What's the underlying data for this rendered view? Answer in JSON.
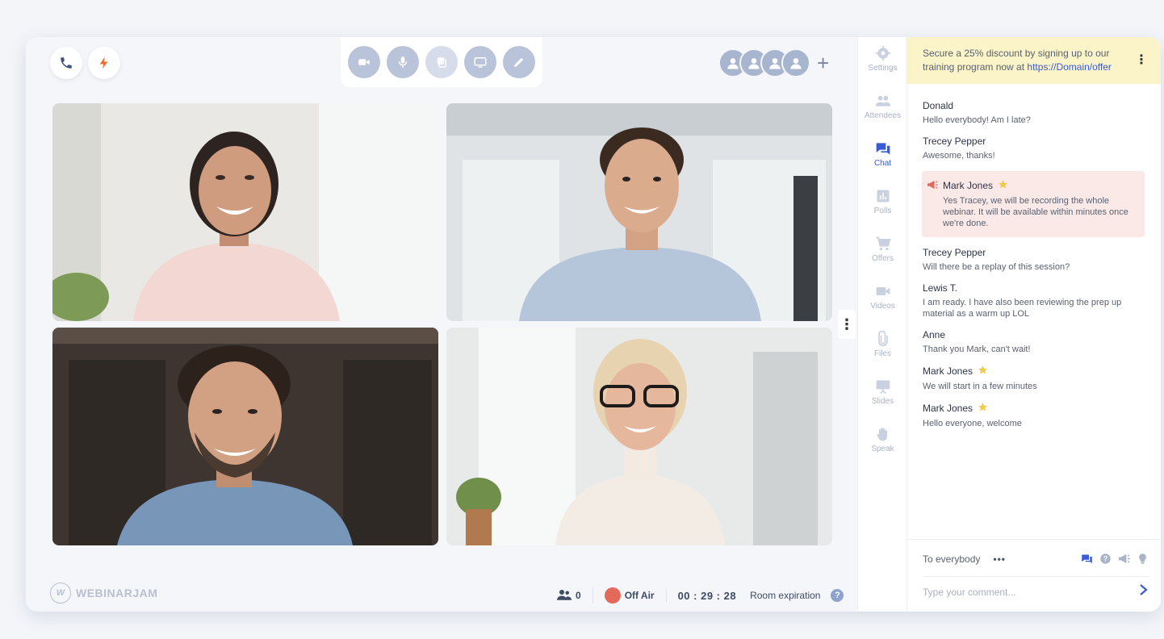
{
  "top_controls": {
    "phone_icon": "phone-icon",
    "flash_icon": "flash-icon",
    "media_icons": [
      "camera-icon",
      "microphone-icon",
      "copy-icon",
      "screen-share-icon",
      "pen-icon"
    ]
  },
  "attendee_add": "+",
  "video_tiles": [
    {
      "name": "presenter-1"
    },
    {
      "name": "presenter-2"
    },
    {
      "name": "presenter-3"
    },
    {
      "name": "presenter-4"
    }
  ],
  "footer": {
    "brand": "WEBINARJAM",
    "brand_mark": "W",
    "attendee_count": "0",
    "broadcast_status": "Off Air",
    "timer": "00 : 29 : 28",
    "room_expiration": "Room expiration",
    "help": "?"
  },
  "nav": {
    "items": [
      {
        "label": "Settings",
        "icon": "gear-icon",
        "active": false
      },
      {
        "label": "Attendees",
        "icon": "people-icon",
        "active": false
      },
      {
        "label": "Chat",
        "icon": "chat-icon",
        "active": true
      },
      {
        "label": "Polls",
        "icon": "poll-icon",
        "active": false
      },
      {
        "label": "Offers",
        "icon": "cart-icon",
        "active": false
      },
      {
        "label": "Videos",
        "icon": "video-icon",
        "active": false
      },
      {
        "label": "Files",
        "icon": "paperclip-icon",
        "active": false
      },
      {
        "label": "Slides",
        "icon": "presentation-icon",
        "active": false
      },
      {
        "label": "Speak",
        "icon": "hand-icon",
        "active": false
      }
    ]
  },
  "chat": {
    "promo": {
      "text": "Secure a 25% discount by signing up to our training program now at",
      "link": "https://Domain/offer"
    },
    "messages": [
      {
        "author": "Donald",
        "text": "Hello everybody! Am I late?"
      },
      {
        "author": "Trecey Pepper",
        "text": "Awesome, thanks!"
      },
      {
        "author": "Mark Jones",
        "text": "Yes Tracey, we will be recording the whole webinar. It will be available within minutes once we're done.",
        "highlight": true
      },
      {
        "author": "Trecey Pepper",
        "text": "Will there be a replay of this session?"
      },
      {
        "author": "Lewis T.",
        "text": "I am ready. I have also been reviewing the prep up material as a warm up LOL"
      },
      {
        "author": "Anne",
        "text": "Thank you Mark, can't wait!"
      },
      {
        "author": "Mark Jones",
        "text": "We will start in a few minutes"
      },
      {
        "author": "Mark Jones",
        "text": "Hello everyone, welcome"
      }
    ],
    "recipient": "To everybody",
    "recipient_more": "•••",
    "comment_placeholder": "Type your comment..."
  },
  "colors": {
    "accent": "#3a5bd6",
    "control_bg": "#b9c4da",
    "record": "#e36a5a",
    "highlight_bg": "#fbe9e8",
    "promo_bg": "#faf4c8",
    "star": "#f2c94c"
  }
}
